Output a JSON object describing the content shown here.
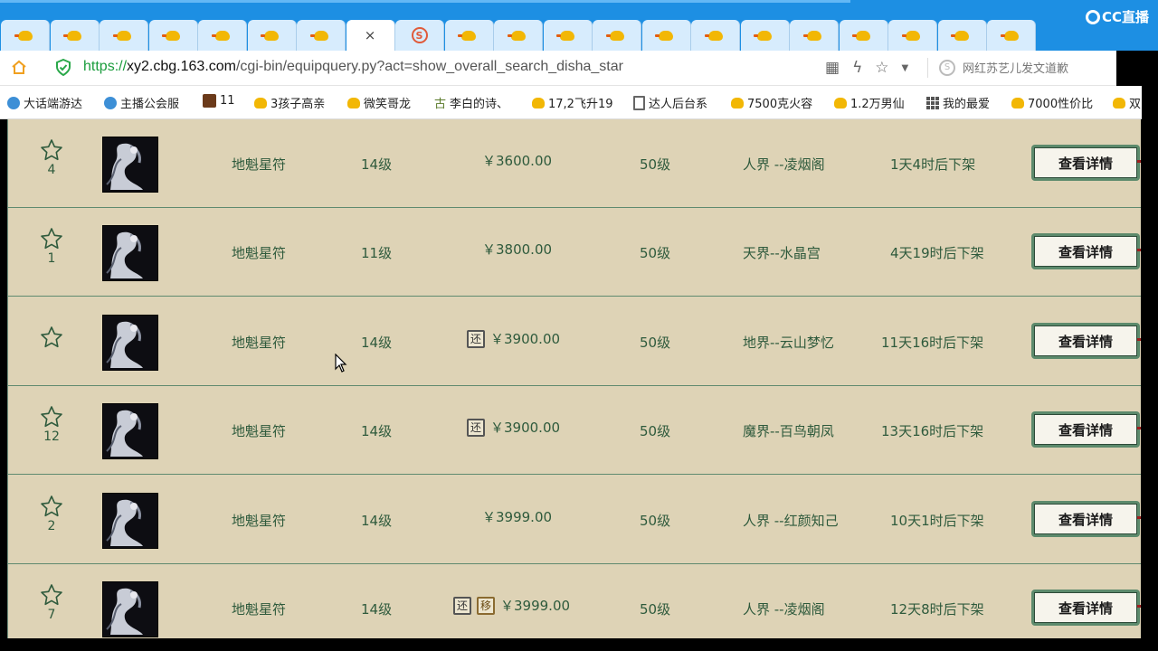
{
  "browser": {
    "tabs_count": 21,
    "active_tab_close": "×",
    "cc_logo": "CC直播",
    "url": {
      "scheme": "https://",
      "host": "xy2.cbg.163.com",
      "path": "/cgi-bin/equipquery.py?act=show_overall_search_disha_star"
    },
    "search_hint": "网红苏艺儿发文道歉"
  },
  "bookmarks": [
    {
      "label": "大话端游达",
      "icon": "blue"
    },
    {
      "label": "主播公会服",
      "icon": "blue"
    },
    {
      "label": "11",
      "icon": "game"
    },
    {
      "label": "3孩子高亲",
      "icon": "chick"
    },
    {
      "label": "微笑哥龙",
      "icon": "chick"
    },
    {
      "label": "李白的诗、",
      "icon": "poem"
    },
    {
      "label": "17,2飞升19",
      "icon": "chick"
    },
    {
      "label": "达人后台系",
      "icon": "doc"
    },
    {
      "label": "7500克火容",
      "icon": "chick"
    },
    {
      "label": "1.2万男仙",
      "icon": "chick"
    },
    {
      "label": "我的最爱",
      "icon": "grid"
    },
    {
      "label": "7000性价比",
      "icon": "chick"
    },
    {
      "label": "双",
      "icon": "chick"
    }
  ],
  "listings": [
    {
      "stars": "4",
      "name": "地魁星符",
      "level": "14级",
      "tags": [],
      "price": "￥3600.00",
      "req_level": "50级",
      "server": "人界 --凌烟阁",
      "time_left": "1天4时后下架",
      "button": "查看详情"
    },
    {
      "stars": "1",
      "name": "地魁星符",
      "level": "11级",
      "tags": [],
      "price": "￥3800.00",
      "req_level": "50级",
      "server": "天界--水晶宫",
      "time_left": "4天19时后下架",
      "button": "查看详情"
    },
    {
      "stars": "",
      "name": "地魁星符",
      "level": "14级",
      "tags": [
        "还"
      ],
      "price": "￥3900.00",
      "req_level": "50级",
      "server": "地界--云山梦忆",
      "time_left": "11天16时后下架",
      "button": "查看详情"
    },
    {
      "stars": "12",
      "name": "地魁星符",
      "level": "14级",
      "tags": [
        "还"
      ],
      "price": "￥3900.00",
      "req_level": "50级",
      "server": "魔界--百鸟朝凤",
      "time_left": "13天16时后下架",
      "button": "查看详情"
    },
    {
      "stars": "2",
      "name": "地魁星符",
      "level": "14级",
      "tags": [],
      "price": "￥3999.00",
      "req_level": "50级",
      "server": "人界 --红颜知己",
      "time_left": "10天1时后下架",
      "button": "查看详情"
    },
    {
      "stars": "7",
      "name": "地魁星符",
      "level": "14级",
      "tags": [
        "还",
        "移"
      ],
      "price": "￥3999.00",
      "req_level": "50级",
      "server": "人界 --凌烟阁",
      "time_left": "12天8时后下架",
      "button": "查看详情"
    }
  ]
}
